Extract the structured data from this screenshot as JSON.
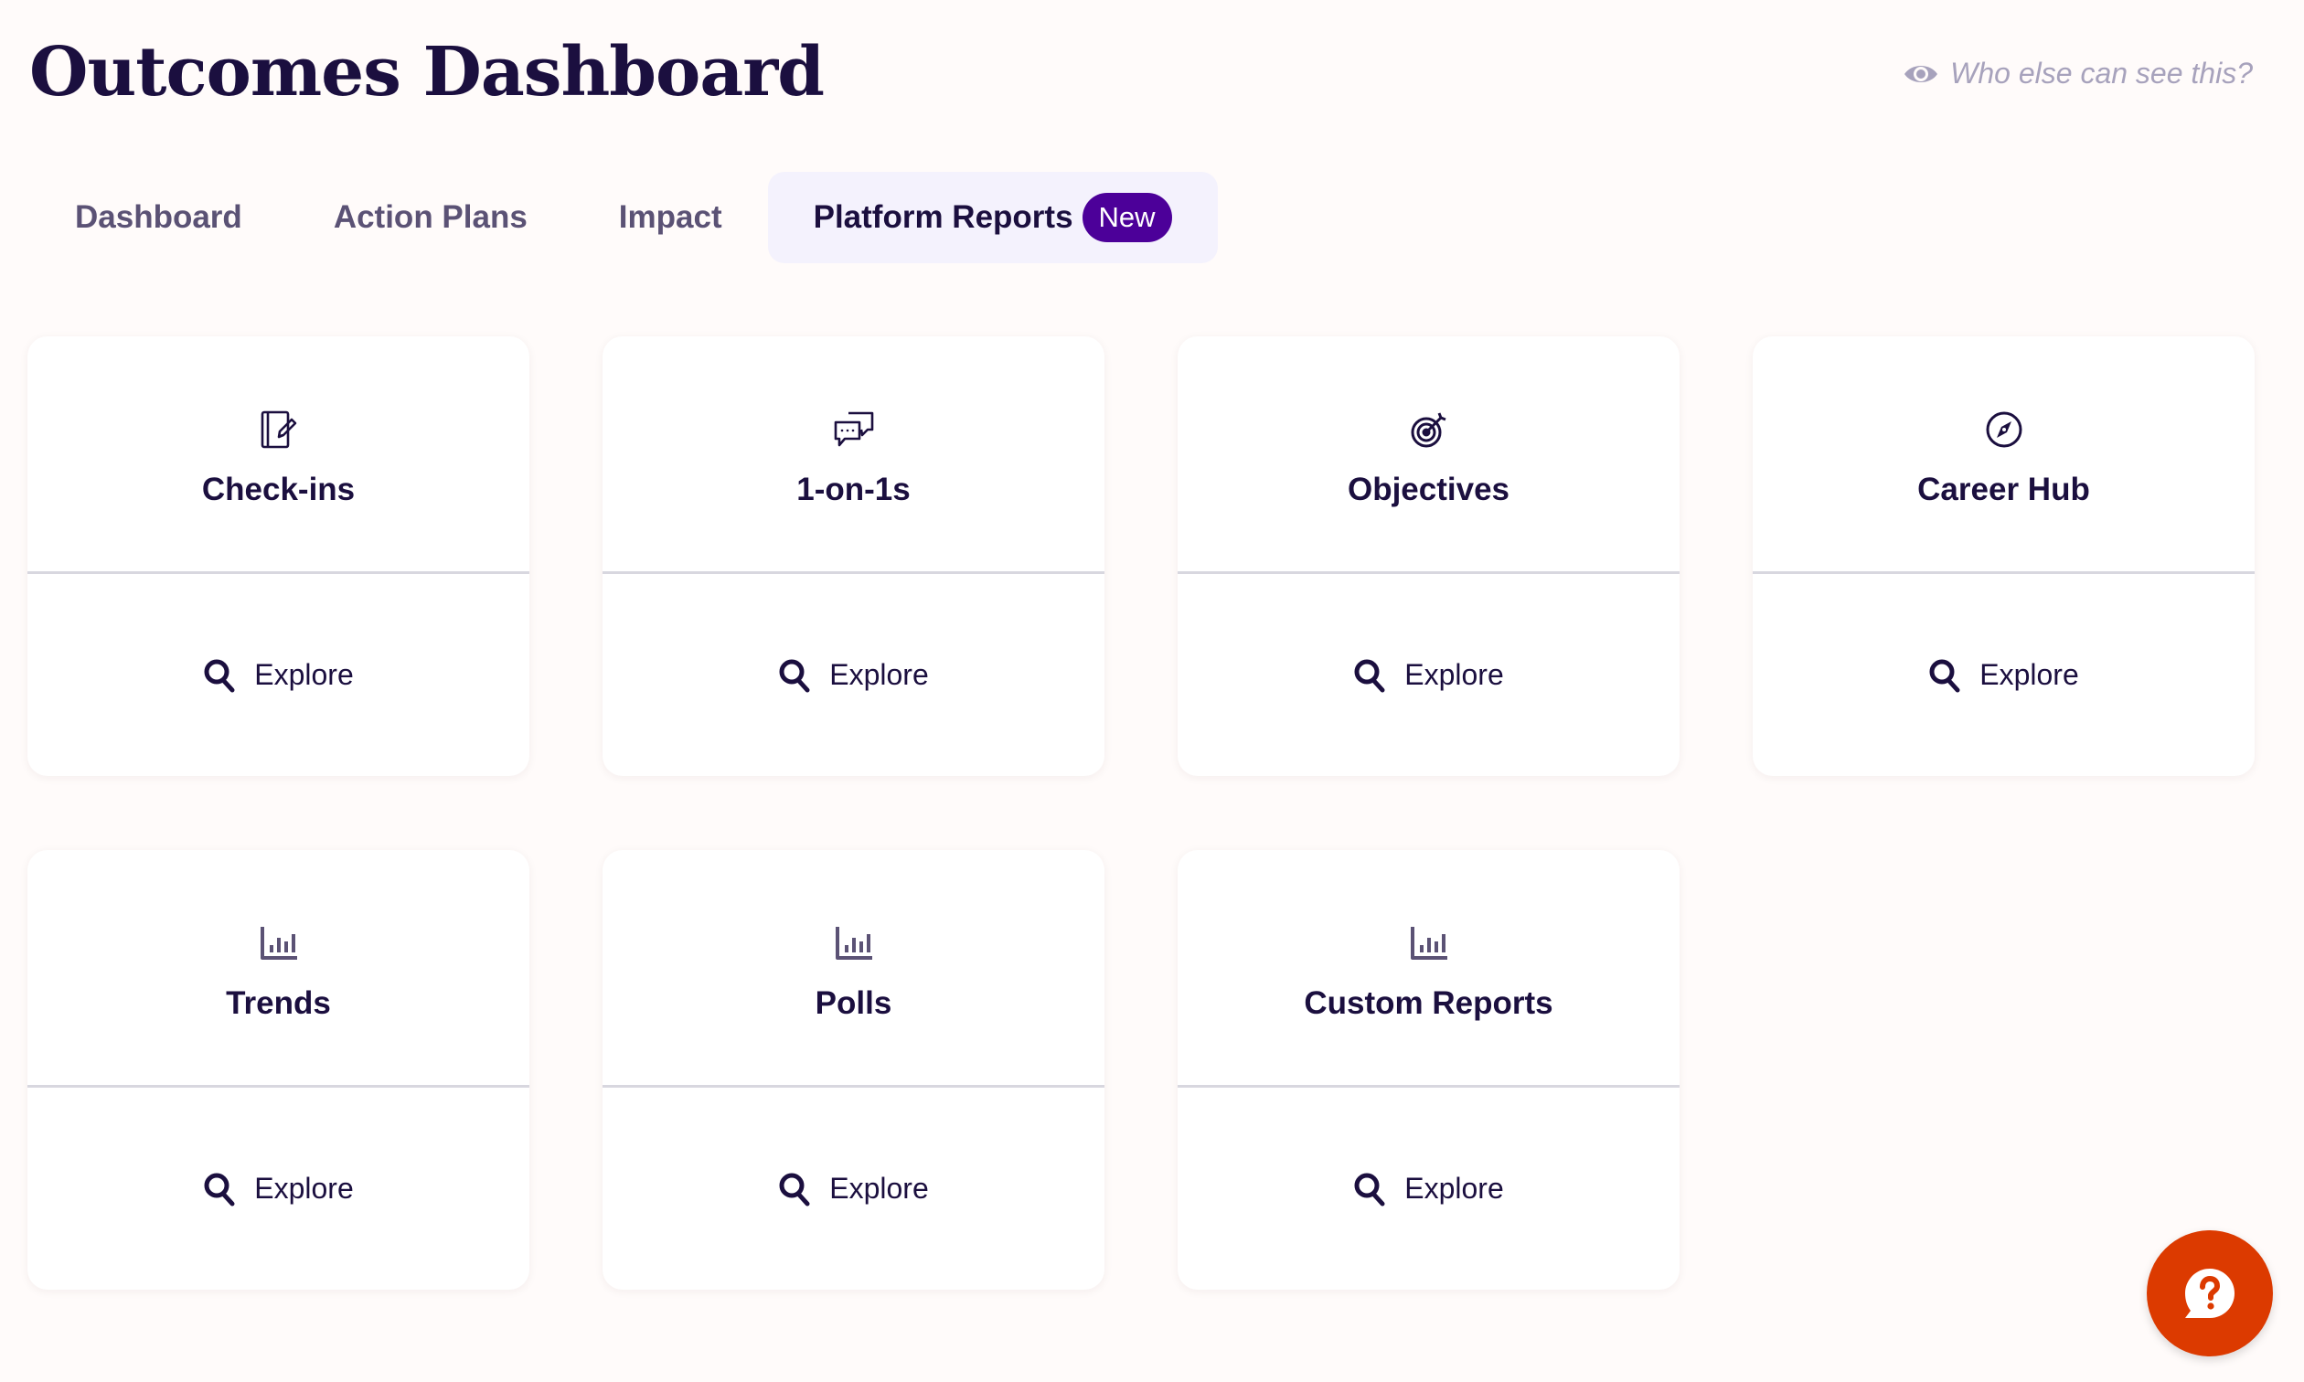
{
  "header": {
    "title": "Outcomes Dashboard",
    "visibility_link": "Who else can see this?",
    "visibility_icon": "eye-icon"
  },
  "tabs": [
    {
      "label": "Dashboard",
      "active": false
    },
    {
      "label": "Action Plans",
      "active": false
    },
    {
      "label": "Impact",
      "active": false
    },
    {
      "label": "Platform Reports",
      "active": true,
      "badge": "New"
    }
  ],
  "cards": [
    {
      "title": "Check-ins",
      "icon": "notebook-pencil-icon",
      "action": "Explore"
    },
    {
      "title": "1-on-1s",
      "icon": "chat-bubbles-icon",
      "action": "Explore"
    },
    {
      "title": "Objectives",
      "icon": "target-icon",
      "action": "Explore"
    },
    {
      "title": "Career Hub",
      "icon": "compass-icon",
      "action": "Explore"
    },
    {
      "title": "Trends",
      "icon": "bar-chart-icon",
      "action": "Explore"
    },
    {
      "title": "Polls",
      "icon": "bar-chart-icon",
      "action": "Explore"
    },
    {
      "title": "Custom Reports",
      "icon": "bar-chart-icon",
      "action": "Explore"
    }
  ],
  "help": {
    "icon": "help-chat-icon"
  },
  "colors": {
    "primary_text": "#1b0f3f",
    "badge": "#4c0099",
    "active_tab_bg": "#f4f2fd",
    "help_button": "#dc3a00",
    "muted_text": "#a7a2bc"
  }
}
